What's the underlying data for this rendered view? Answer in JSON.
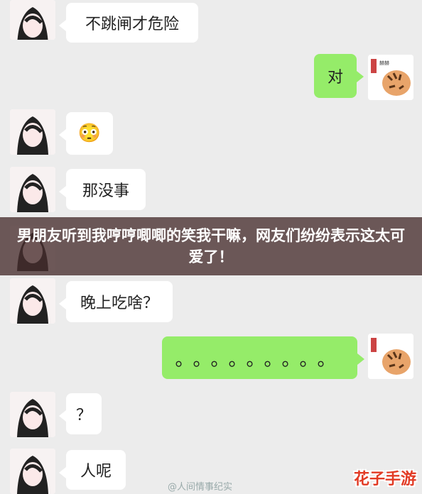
{
  "messages": [
    {
      "side": "left",
      "text": "不跳闸才危险"
    },
    {
      "side": "right",
      "text": "对"
    },
    {
      "side": "left",
      "text": "😳"
    },
    {
      "side": "left",
      "text": "那没事"
    },
    {
      "side": "left",
      "text": "晚上吃啥？"
    },
    {
      "side": "right",
      "text": "。。。。。。。。。"
    },
    {
      "side": "left",
      "text": "？"
    },
    {
      "side": "left",
      "text": "人呢"
    }
  ],
  "banner": {
    "title": "男朋友听到我哼哼唧唧的笑我干嘛，网友们纷纷表示这太可爱了！"
  },
  "watermark": "人间情事纪实",
  "site_logo": "花子手游",
  "colors": {
    "right_bubble": "#95ec69",
    "left_bubble": "#ffffff",
    "background": "#ececec"
  }
}
